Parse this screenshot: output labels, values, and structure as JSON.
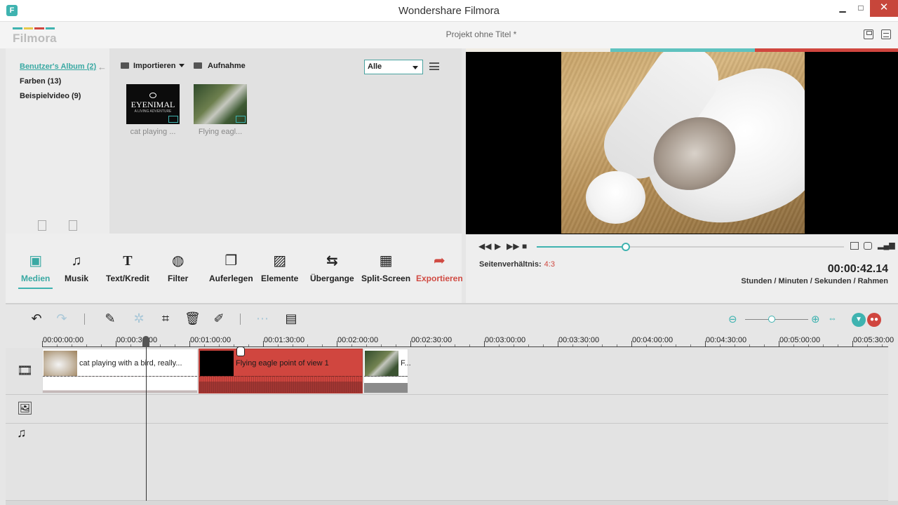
{
  "window": {
    "title": "Wondershare Filmora",
    "minimize": "▁",
    "maximize": "□",
    "close": "✕"
  },
  "header": {
    "logo_text": "Filmora",
    "project_title": "Projekt ohne Titel *"
  },
  "library": {
    "albums": [
      {
        "label": "Benutzer's Album (2)",
        "active": true
      },
      {
        "label": "Farben (13)",
        "active": false
      },
      {
        "label": "Beispielvideo (9)",
        "active": false
      }
    ],
    "import_label": "Importieren",
    "record_label": "Aufnahme",
    "filter_value": "Alle",
    "media": [
      {
        "label": "cat playing ...",
        "brand": "EYENIMAL",
        "brand_sub": "A LIVING ADVENTURE"
      },
      {
        "label": "Flying eagl..."
      }
    ]
  },
  "toolbar": {
    "items": [
      {
        "label": "Medien",
        "icon": "▣"
      },
      {
        "label": "Musik",
        "icon": "♫"
      },
      {
        "label": "Text/Kredit",
        "icon": "T"
      },
      {
        "label": "Filter",
        "icon": "◍"
      },
      {
        "label": "Auferlegen",
        "icon": "❐"
      },
      {
        "label": "Elemente",
        "icon": "▨"
      },
      {
        "label": "Übergange",
        "icon": "⇆"
      },
      {
        "label": "Split-Screen",
        "icon": "▦"
      },
      {
        "label": "Exportieren",
        "icon": "➦"
      }
    ]
  },
  "player": {
    "progress_fraction": 0.29,
    "aspect_label": "Seitenverhältnis:",
    "aspect_value": "4:3",
    "timecode": "00:00:42.14",
    "timecode_label": "Stunden / Minuten / Sekunden / Rahmen"
  },
  "timeline": {
    "ruler": [
      "00:00:00:00",
      "00:00:30:00",
      "00:01:00:00",
      "00:01:30:00",
      "00:02:00:00",
      "00:02:30:00",
      "00:03:00:00",
      "00:03:30:00",
      "00:04:00:00",
      "00:04:30:00",
      "00:05:00:00",
      "00:05:30:00"
    ],
    "clips": [
      {
        "title": "cat playing with a bird, really..."
      },
      {
        "title": "Flying eagle point of view 1"
      },
      {
        "title": "F..."
      }
    ],
    "zoom_level_fraction": 0.45
  },
  "colors": {
    "accent": "#3fb3b0",
    "export": "#d04a42",
    "selected_clip": "#d0463f"
  }
}
